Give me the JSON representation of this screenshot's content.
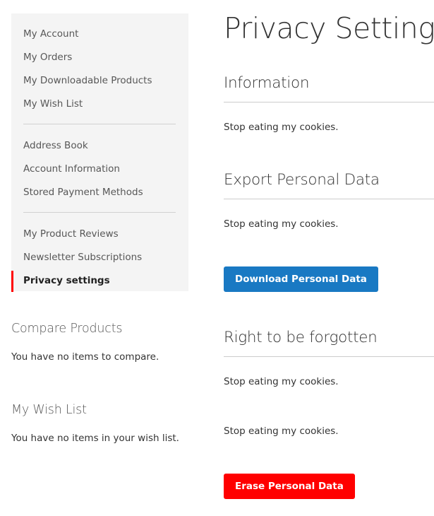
{
  "sidebar": {
    "groups": [
      [
        {
          "label": "My Account",
          "active": false
        },
        {
          "label": "My Orders",
          "active": false
        },
        {
          "label": "My Downloadable Products",
          "active": false
        },
        {
          "label": "My Wish List",
          "active": false
        }
      ],
      [
        {
          "label": "Address Book",
          "active": false
        },
        {
          "label": "Account Information",
          "active": false
        },
        {
          "label": "Stored Payment Methods",
          "active": false
        }
      ],
      [
        {
          "label": "My Product Reviews",
          "active": false
        },
        {
          "label": "Newsletter Subscriptions",
          "active": false
        },
        {
          "label": "Privacy settings",
          "active": true
        }
      ]
    ],
    "active_accent": "#ff0000"
  },
  "compare": {
    "title": "Compare Products",
    "text": "You have no items to compare."
  },
  "wishlist": {
    "title": "My Wish List",
    "text": "You have no items in your wish list."
  },
  "main": {
    "page_title": "Privacy Settings",
    "information": {
      "title": "Information",
      "text": "Stop eating my cookies."
    },
    "export": {
      "title": "Export Personal Data",
      "text": "Stop eating my cookies.",
      "button_label": "Download Personal Data",
      "button_color": "#1979c3"
    },
    "forget": {
      "title": "Right to be forgotten",
      "text_1": "Stop eating my cookies.",
      "text_2": "Stop eating my cookies.",
      "button_label": "Erase Personal Data",
      "button_color": "#ff0000"
    }
  }
}
